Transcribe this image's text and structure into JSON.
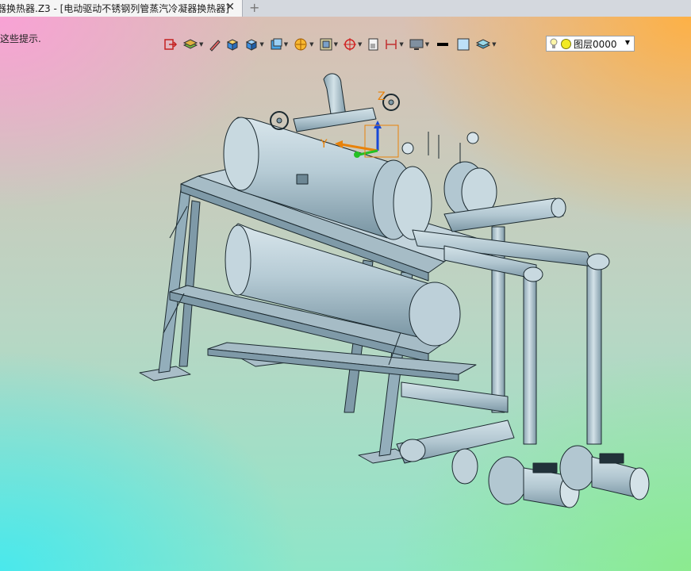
{
  "tabs": {
    "active_title": "器换热器.Z3 - [电动驱动不锈钢列管蒸汽冷凝器换热器]",
    "close_glyph": "✕",
    "new_glyph": "+"
  },
  "viewport": {
    "hint_text": "这些提示."
  },
  "toolbar": {
    "layer_label": "图层0000",
    "icons": [
      "exit-icon",
      "layers-stack-icon",
      "pencil-icon",
      "solid-shade-icon",
      "cube-view-icon",
      "cube-blue-icon",
      "render-ball-icon",
      "frame-icon",
      "target-icon",
      "page-icon",
      "dimension-icon",
      "monitor-icon",
      "line-weight-icon",
      "color-swatch-icon",
      "material-icon",
      "light-bulb-icon"
    ]
  },
  "model": {
    "axes": {
      "z": "Z",
      "y": "Y"
    }
  },
  "colors": {
    "metal": "#b9cdd6",
    "metal_dark": "#7f9aa8",
    "outline": "#1c2a30",
    "axis_z": "#1848d8",
    "axis_y": "#e8820a",
    "axis_x": "#24c024"
  }
}
